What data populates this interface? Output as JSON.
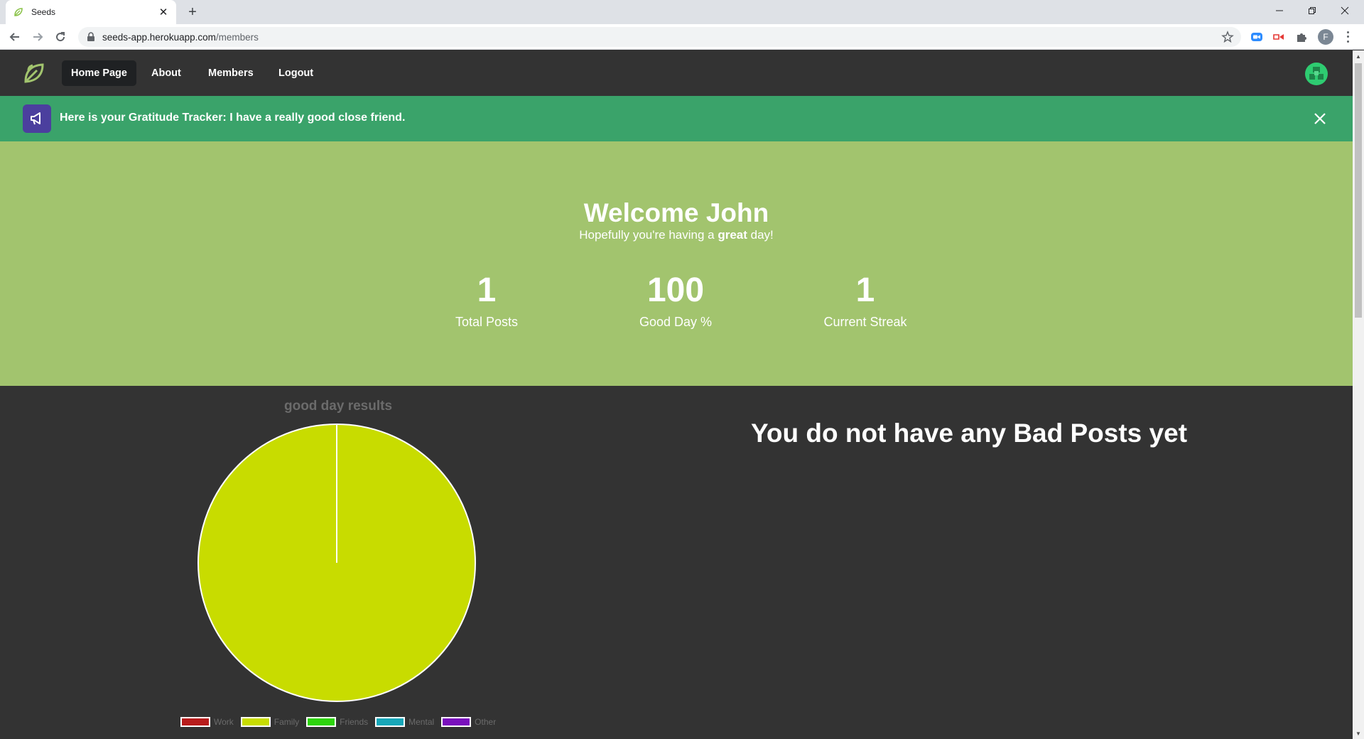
{
  "browser": {
    "tab_title": "Seeds",
    "url_host": "seeds-app.herokuapp.com",
    "url_path": "/members",
    "profile_initial": "F"
  },
  "nav": {
    "items": [
      {
        "label": "Home Page",
        "active": true
      },
      {
        "label": "About",
        "active": false
      },
      {
        "label": "Members",
        "active": false
      },
      {
        "label": "Logout",
        "active": false
      }
    ]
  },
  "banner": {
    "message": "Here is your Gratitude Tracker: I have a really good close friend."
  },
  "hero": {
    "title": "Welcome John",
    "subtitle_before": "Hopefully you're having a ",
    "subtitle_bold": "great",
    "subtitle_after": " day!",
    "stats": [
      {
        "value": "1",
        "label": "Total Posts"
      },
      {
        "value": "100",
        "label": "Good Day %"
      },
      {
        "value": "1",
        "label": "Current Streak"
      }
    ]
  },
  "bad_posts_message": "You do not have any Bad Posts yet",
  "chart_data": {
    "type": "pie",
    "title": "good day results",
    "categories": [
      "Work",
      "Family",
      "Friends",
      "Mental",
      "Other"
    ],
    "values": [
      0,
      1,
      0,
      0,
      0
    ],
    "colors": [
      "#b71c1c",
      "#c8dc00",
      "#2ed30d",
      "#17a6b8",
      "#7a0fbd"
    ],
    "legend_position": "bottom"
  },
  "colors": {
    "hero_bg": "#a2c46e",
    "banner_bg": "#3aa36a",
    "page_bg": "#333333"
  }
}
